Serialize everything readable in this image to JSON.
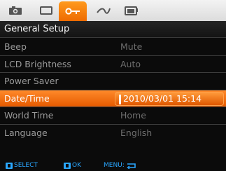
{
  "tabs": [
    {
      "icon": "camera-icon"
    },
    {
      "icon": "display-icon"
    },
    {
      "icon": "setup-wrench-icon",
      "active": true
    },
    {
      "icon": "transfer-icon"
    },
    {
      "icon": "memory-card-icon"
    }
  ],
  "header": {
    "title": "General Setup"
  },
  "menu": {
    "items": [
      {
        "label": "Beep",
        "value": "Mute"
      },
      {
        "label": "LCD Brightness",
        "value": "Auto"
      },
      {
        "label": "Power Saver",
        "value": ""
      },
      {
        "label": "Date/Time",
        "value": "2010/03/01 15:14",
        "selected": true
      },
      {
        "label": "World Time",
        "value": "Home"
      },
      {
        "label": "Language",
        "value": "English"
      }
    ]
  },
  "footer": {
    "select_label": "SELECT",
    "ok_label": "OK",
    "menu_label": "MENU:"
  },
  "colors": {
    "accent": "#f07a10",
    "hint": "#2aa7ff"
  }
}
